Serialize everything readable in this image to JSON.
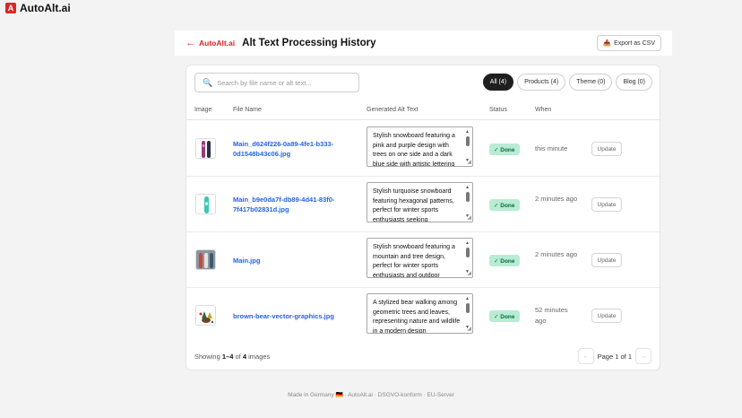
{
  "app": {
    "name": "AutoAlt.ai",
    "logo_letter": "A",
    "brand_color": "#dc2626"
  },
  "header": {
    "back_label": "AutoAlt.ai",
    "title": "Alt Text Processing History",
    "export_label": "Export as CSV",
    "export_icon": "inbox-tray-icon"
  },
  "search": {
    "placeholder": "Search by file name or alt text...",
    "value": ""
  },
  "filters": [
    {
      "label": "All (4)",
      "active": true
    },
    {
      "label": "Products (4)",
      "active": false
    },
    {
      "label": "Theme (0)",
      "active": false
    },
    {
      "label": "Blog (0)",
      "active": false
    }
  ],
  "table": {
    "columns": [
      "Image",
      "File Name",
      "Generated Alt Text",
      "Status",
      "When"
    ],
    "rows": [
      {
        "file": "Main_d624f226-0a89-4fe1-b333-0d1548b43c06.jpg",
        "alt": "Stylish snowboard featuring a pink and purple design with trees on one side and a dark blue side with artistic lettering",
        "status": "✓ Done",
        "when": "this minute",
        "action": "Update"
      },
      {
        "file": "Main_b9e0da7f-db89-4d41-83f0-7f417b02831d.jpg",
        "alt": "Stylish turquoise snowboard featuring hexagonal patterns, perfect for winter sports enthusiasts seeking",
        "status": "✓ Done",
        "when": "2 minutes ago",
        "action": "Update"
      },
      {
        "file": "Main.jpg",
        "alt": "Stylish snowboard featuring a mountain and tree design, perfect for winter sports enthusiasts and outdoor",
        "status": "✓ Done",
        "when": "2 minutes ago",
        "action": "Update"
      },
      {
        "file": "brown-bear-vector-graphics.jpg",
        "alt": "A stylized bear walking among geometric trees and leaves, representing nature and wildlife in a modern design",
        "status": "✓ Done",
        "when": "52 minutes ago",
        "action": "Update"
      }
    ]
  },
  "pagination": {
    "showing_prefix": "Showing",
    "range": "1–4",
    "of": "of",
    "total": "4",
    "suffix": "images",
    "page_label": "Page 1 of 1",
    "prev": "←",
    "next": "→"
  },
  "footer": {
    "text": "Made in Germany 🇩🇪 · AutoAlt.ai · DSGVO-konform · EU-Server"
  }
}
